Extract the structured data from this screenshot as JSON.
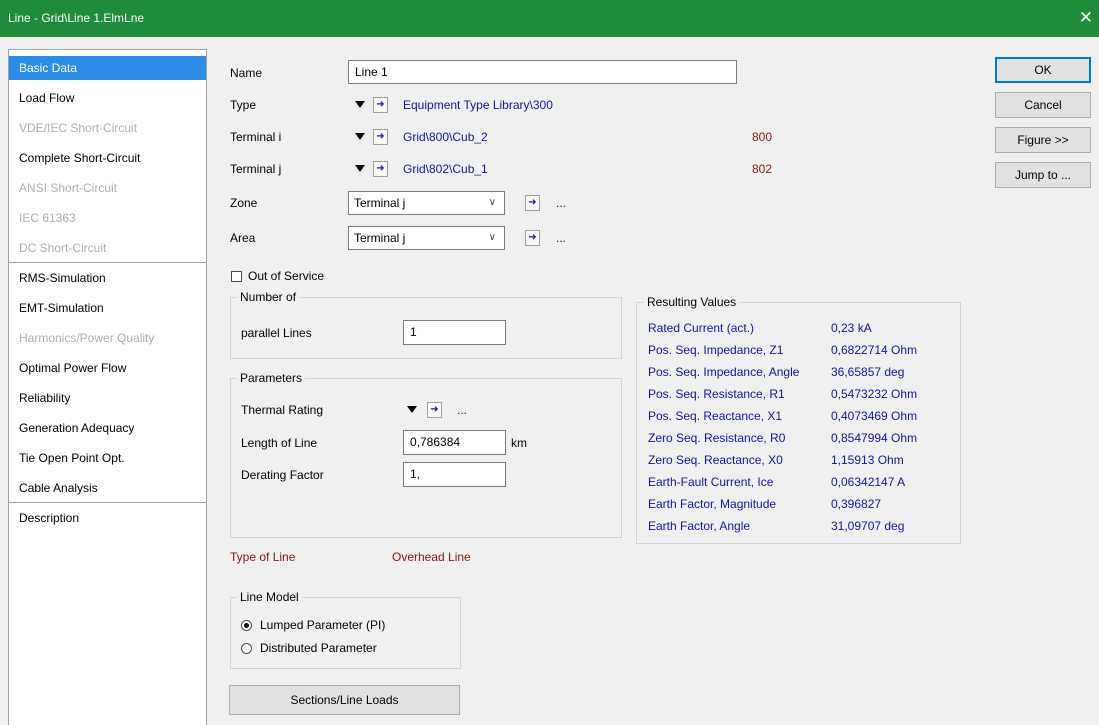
{
  "window": {
    "title": "Line - Grid\\Line 1.ElmLne",
    "close_glyph": "✕"
  },
  "sidebar": {
    "items": [
      {
        "label": "Basic Data",
        "state": "active"
      },
      {
        "label": "Load Flow",
        "state": "normal"
      },
      {
        "label": "VDE/IEC Short-Circuit",
        "state": "disabled"
      },
      {
        "label": "Complete Short-Circuit",
        "state": "normal"
      },
      {
        "label": "ANSI Short-Circuit",
        "state": "disabled"
      },
      {
        "label": "IEC 61363",
        "state": "disabled"
      },
      {
        "label": "DC Short-Circuit",
        "state": "disabled"
      },
      {
        "label": "RMS-Simulation",
        "state": "normal"
      },
      {
        "label": "EMT-Simulation",
        "state": "normal"
      },
      {
        "label": "Harmonics/Power Quality",
        "state": "disabled"
      },
      {
        "label": "Optimal Power Flow",
        "state": "normal"
      },
      {
        "label": "Reliability",
        "state": "normal"
      },
      {
        "label": "Generation Adequacy",
        "state": "normal"
      },
      {
        "label": "Tie Open Point Opt.",
        "state": "normal"
      },
      {
        "label": "Cable Analysis",
        "state": "normal"
      },
      {
        "label": "Description",
        "state": "normal"
      }
    ]
  },
  "form": {
    "name_label": "Name",
    "name_value": "Line 1",
    "type_label": "Type",
    "type_value": "Equipment Type Library\\300",
    "terminal_i_label": "Terminal i",
    "terminal_i_value": "Grid\\800\\Cub_2",
    "terminal_i_node": "800",
    "terminal_j_label": "Terminal j",
    "terminal_j_value": "Grid\\802\\Cub_1",
    "terminal_j_node": "802",
    "zone_label": "Zone",
    "zone_value": "Terminal j",
    "area_label": "Area",
    "area_value": "Terminal j",
    "out_of_service_label": "Out of Service",
    "out_of_service_checked": false,
    "ellipsis": "...",
    "arrow_glyph": "➜"
  },
  "number_of": {
    "title": "Number of",
    "parallel_label": "parallel Lines",
    "parallel_value": "1"
  },
  "parameters": {
    "title": "Parameters",
    "thermal_label": "Thermal Rating",
    "length_label": "Length of Line",
    "length_value": "0,786384",
    "length_unit": "km",
    "derating_label": "Derating Factor",
    "derating_value": "1,"
  },
  "line_type": {
    "label": "Type of Line",
    "value": "Overhead Line"
  },
  "line_model": {
    "title": "Line Model",
    "options": [
      {
        "label": "Lumped Parameter (PI)",
        "selected": true
      },
      {
        "label": "Distributed Parameter",
        "selected": false
      }
    ]
  },
  "sections_button": "Sections/Line Loads",
  "results": {
    "title": "Resulting Values",
    "rows": [
      {
        "label": "Rated Current (act.)",
        "value": "0,23 kA"
      },
      {
        "label": "Pos. Seq. Impedance, Z1",
        "value": "0,6822714 Ohm"
      },
      {
        "label": "Pos. Seq. Impedance, Angle",
        "value": "36,65857 deg"
      },
      {
        "label": "Pos. Seq. Resistance, R1",
        "value": "0,5473232 Ohm"
      },
      {
        "label": "Pos. Seq. Reactance, X1",
        "value": "0,4073469 Ohm"
      },
      {
        "label": "Zero Seq. Resistance, R0",
        "value": "0,8547994 Ohm"
      },
      {
        "label": "Zero Seq. Reactance, X0",
        "value": "1,15913 Ohm"
      },
      {
        "label": "Earth-Fault Current, Ice",
        "value": "0,06342147 A"
      },
      {
        "label": "Earth Factor, Magnitude",
        "value": "0,396827"
      },
      {
        "label": "Earth Factor, Angle",
        "value": "31,09707 deg"
      }
    ]
  },
  "buttons": {
    "ok": "OK",
    "cancel": "Cancel",
    "figure": "Figure >>",
    "jump": "Jump to ..."
  },
  "colors": {
    "titlebar": "#1e8c3a",
    "selection": "#2d8ce6",
    "link_blue": "#1414a0",
    "maroon": "#8a1414",
    "disabled": "#aab0b8"
  },
  "icons": {
    "close": "close-icon",
    "dropdown": "dropdown-triangle-icon",
    "jump": "jump-arrow-icon",
    "chevron": "chevron-down-icon"
  }
}
